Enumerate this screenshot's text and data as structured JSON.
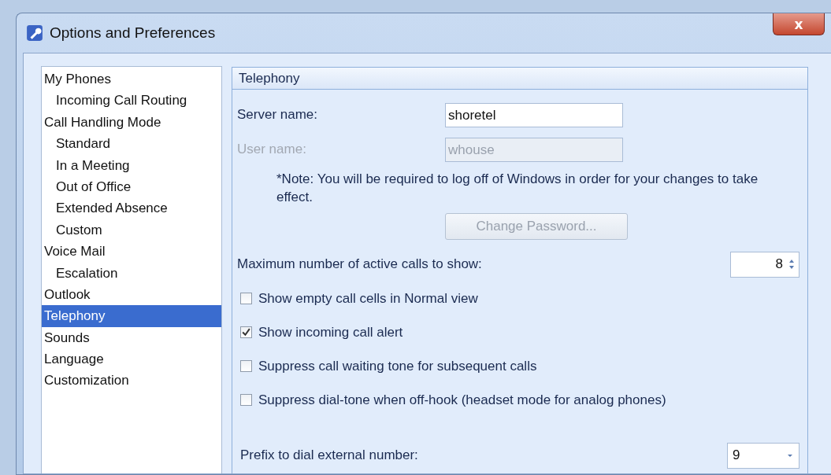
{
  "window": {
    "title": "Options and Preferences",
    "close": "x"
  },
  "sidebar": {
    "items": [
      {
        "label": "My Phones",
        "selected": false,
        "children": [
          {
            "label": "Incoming Call Routing",
            "selected": false
          }
        ]
      },
      {
        "label": "Call Handling Mode",
        "selected": false,
        "children": [
          {
            "label": "Standard",
            "selected": false
          },
          {
            "label": "In a Meeting",
            "selected": false
          },
          {
            "label": "Out of Office",
            "selected": false
          },
          {
            "label": "Extended Absence",
            "selected": false
          },
          {
            "label": "Custom",
            "selected": false
          }
        ]
      },
      {
        "label": "Voice Mail",
        "selected": false,
        "children": [
          {
            "label": "Escalation",
            "selected": false
          }
        ]
      },
      {
        "label": "Outlook",
        "selected": false
      },
      {
        "label": "Telephony",
        "selected": true
      },
      {
        "label": "Sounds",
        "selected": false
      },
      {
        "label": "Language",
        "selected": false
      },
      {
        "label": "Customization",
        "selected": false
      }
    ]
  },
  "panel": {
    "title": "Telephony",
    "rows": [
      {
        "kind": "text",
        "label": "Server name:",
        "value": "shoretel",
        "disabled": false
      },
      {
        "kind": "text",
        "label": "User name:",
        "value": "whouse",
        "disabled": true
      },
      {
        "kind": "note",
        "text": "*Note: You will be required to log off of Windows in order for your changes to take effect."
      },
      {
        "kind": "button",
        "label": "Change Password...",
        "disabled": true
      },
      {
        "kind": "spin",
        "label": "Maximum number of active calls to show:",
        "value": "8"
      },
      {
        "kind": "check",
        "label": "Show empty call cells in Normal view",
        "checked": false
      },
      {
        "kind": "check",
        "label": "Show incoming call alert",
        "checked": true
      },
      {
        "kind": "check",
        "label": "Suppress call waiting tone for subsequent calls",
        "checked": false
      },
      {
        "kind": "check",
        "label": "Suppress dial-tone when off-hook (headset mode for analog phones)",
        "checked": false
      },
      {
        "kind": "combo",
        "label": "Prefix to dial external number:",
        "value": "9"
      }
    ]
  }
}
